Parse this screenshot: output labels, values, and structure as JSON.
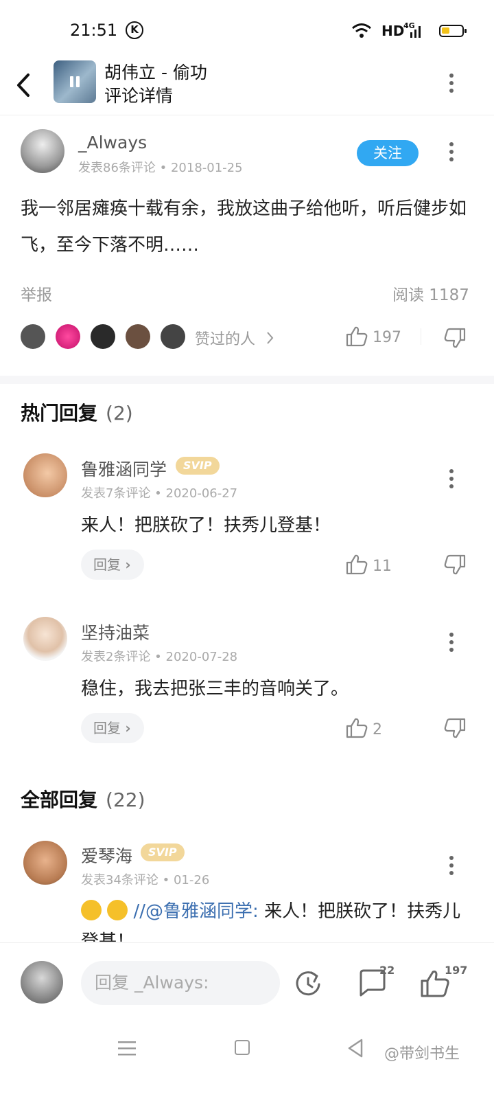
{
  "status": {
    "time": "21:51",
    "hd": "HD",
    "network": "4G"
  },
  "header": {
    "song": "胡伟立 - 偷功",
    "subtitle": "评论详情"
  },
  "main_comment": {
    "username": "_Always",
    "meta": "发表86条评论 • 2018-01-25",
    "follow_label": "关注",
    "text": "我一邻居瘫痪十载有余，我放这曲子给他听，听后健步如飞，至今下落不明……",
    "report_label": "举报",
    "read_label": "阅读 1187",
    "liked_by_label": "赞过的人",
    "like_count": "197"
  },
  "hot": {
    "title": "热门回复",
    "count": "(2)"
  },
  "hot_replies": [
    {
      "username": "鲁雅涵同学",
      "badge": "SVIP",
      "meta": "发表7条评论 • 2020-06-27",
      "text": "来人！把朕砍了！扶秀儿登基！",
      "reply_label": "回复",
      "likes": "11"
    },
    {
      "username": "坚持油菜",
      "meta": "发表2条评论 • 2020-07-28",
      "text": "稳住，我去把张三丰的音响关了。",
      "reply_label": "回复",
      "likes": "2"
    }
  ],
  "all": {
    "title": "全部回复",
    "count": "(22)"
  },
  "all_replies": [
    {
      "username": "爱琴海",
      "badge": "SVIP",
      "meta": "发表34条评论 • 01-26",
      "mention": "//@鲁雅涵同学:",
      "text": " 来人！把朕砍了！扶秀儿登基！"
    }
  ],
  "bottom": {
    "placeholder": "回复 _Always:",
    "comment_count": "22",
    "like_count": "197"
  },
  "watermark": "@带剑书生",
  "colors": {
    "accent": "#31a8f2",
    "svip": "#f2d79a",
    "mention": "#3c6fb0"
  }
}
